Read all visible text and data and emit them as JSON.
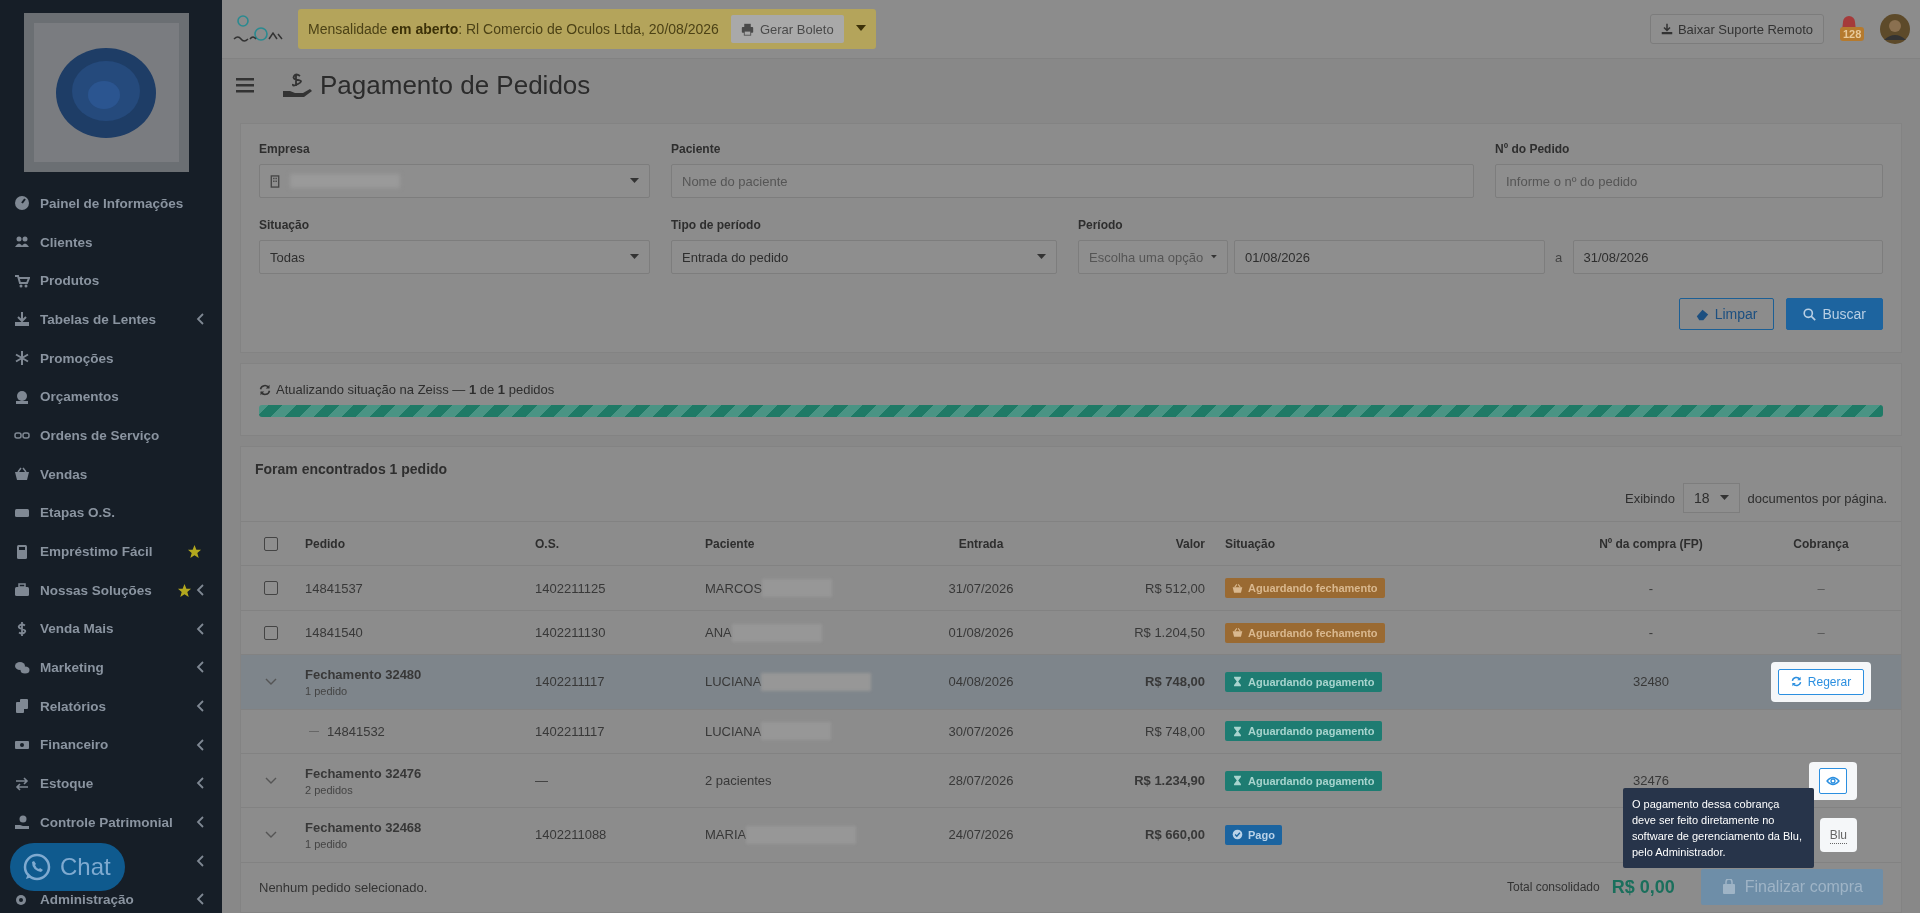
{
  "sidebar": {
    "items": [
      {
        "label": "Painel de Informações",
        "chevron": false,
        "star": false
      },
      {
        "label": "Clientes",
        "chevron": false,
        "star": false
      },
      {
        "label": "Produtos",
        "chevron": false,
        "star": false
      },
      {
        "label": "Tabelas de Lentes",
        "chevron": true,
        "star": false
      },
      {
        "label": "Promoções",
        "chevron": false,
        "star": false
      },
      {
        "label": "Orçamentos",
        "chevron": false,
        "star": false
      },
      {
        "label": "Ordens de Serviço",
        "chevron": false,
        "star": false
      },
      {
        "label": "Vendas",
        "chevron": false,
        "star": false
      },
      {
        "label": "Etapas O.S.",
        "chevron": false,
        "star": false
      },
      {
        "label": "Empréstimo Fácil",
        "chevron": false,
        "star": true
      },
      {
        "label": "Nossas Soluções",
        "chevron": true,
        "star": true
      },
      {
        "label": "Venda Mais",
        "chevron": true,
        "star": false
      },
      {
        "label": "Marketing",
        "chevron": true,
        "star": false
      },
      {
        "label": "Relatórios",
        "chevron": true,
        "star": false
      },
      {
        "label": "Financeiro",
        "chevron": true,
        "star": false
      },
      {
        "label": "Estoque",
        "chevron": true,
        "star": false
      },
      {
        "label": "Controle Patrimonial",
        "chevron": true,
        "star": false
      },
      {
        "chevron": true,
        "star": false
      },
      {
        "label": "Administração",
        "chevron": true,
        "star": false
      }
    ],
    "chat_button": "Chat"
  },
  "topbar": {
    "notice": {
      "text": "Mensalidade **em aberto**: Rl Comercio de Oculos Ltda, 20/08/2026",
      "button": "Gerar Boleto"
    },
    "support_button": "Baixar Suporte Remoto",
    "notifications": "128"
  },
  "page": {
    "title": "Pagamento de Pedidos"
  },
  "filters": {
    "fields": [
      {
        "label": "Empresa",
        "kind": "select"
      },
      {
        "label": "Paciente",
        "kind": "input",
        "placeholder": "Nome do paciente"
      },
      {
        "label": "Nº do Pedido",
        "kind": "input",
        "placeholder": "Informe o nº do pedido"
      },
      {
        "label": "Situação",
        "kind": "select",
        "value": "Todas"
      },
      {
        "label": "Tipo de período",
        "kind": "select",
        "value": "Entrada do pedido"
      },
      {
        "label": "Período",
        "kind": "range",
        "placeholder": "Escolha uma opção",
        "from": "01/08/2026",
        "separator": "a",
        "to": "31/08/2026"
      }
    ],
    "buttons": [
      {
        "label": "Limpar",
        "kind": "outline"
      },
      {
        "label": "Buscar",
        "kind": "primary"
      }
    ]
  },
  "progress": {
    "text": "Atualizando situação na Zeiss — **1** de **1** pedidos",
    "level": 1
  },
  "results": {
    "title": "Foram encontrados 1 pedido",
    "page_size": {
      "prefix": "Exibindo",
      "value": "18",
      "suffix": "documentos por página."
    },
    "select_all_checked": false,
    "columns": [
      "Pedido",
      "O.S.",
      "Paciente",
      "Entrada",
      "Valor",
      "Situação",
      "Nº da compra (FP)",
      "Cobrança"
    ],
    "rows": [
      {
        "kind": "order",
        "checked": false,
        "highlighted": false,
        "pedido": "14841537",
        "os": "1402211125",
        "paciente": "MARCOS",
        "redacted": true,
        "entrada": "31/07/2026",
        "valor": "R$ 512,00",
        "status": {
          "label": "Aguardando fechamento",
          "kind": "waiting_close"
        },
        "compra": "-",
        "cobranca": {
          "kind": "none",
          "text": "–"
        }
      },
      {
        "kind": "order",
        "checked": false,
        "highlighted": false,
        "pedido": "14841540",
        "os": "1402211130",
        "paciente": "ANA",
        "redacted": true,
        "entrada": "01/08/2026",
        "valor": "R$ 1.204,50",
        "status": {
          "label": "Aguardando fechamento",
          "kind": "waiting_close"
        },
        "compra": "-",
        "cobranca": {
          "kind": "none",
          "text": "–"
        }
      },
      {
        "kind": "closing",
        "highlighted": true,
        "pedido": "Fechamento 32480",
        "sub": "1 pedido",
        "os": "1402211117",
        "paciente": "LUCIANA",
        "redacted": true,
        "entrada": "04/08/2026",
        "valor": "R$ 748,00",
        "status": {
          "label": "Aguardando pagamento",
          "kind": "waiting_payment"
        },
        "compra": "32480",
        "cobranca": {
          "kind": "regenerate",
          "text": "Regerar"
        }
      },
      {
        "kind": "child",
        "highlighted": false,
        "pedido": "14841532",
        "os": "1402211117",
        "paciente": "LUCIANA",
        "redacted": true,
        "entrada": "30/07/2026",
        "valor": "R$ 748,00",
        "status": {
          "label": "Aguardando pagamento",
          "kind": "waiting_payment"
        }
      },
      {
        "kind": "closing",
        "highlighted": false,
        "pedido": "Fechamento 32476",
        "sub": "2 pedidos",
        "os": "—",
        "paciente": "2 pacientes",
        "redacted": false,
        "entrada": "28/07/2026",
        "valor": "R$ 1.234,90",
        "status": {
          "label": "Aguardando pagamento",
          "kind": "waiting_payment"
        },
        "compra": "32476",
        "cobranca": {
          "kind": "view"
        }
      },
      {
        "kind": "closing",
        "highlighted": false,
        "pedido": "Fechamento 32468",
        "sub": "1 pedido",
        "os": "1402211088",
        "paciente": "MARIA",
        "redacted": true,
        "entrada": "24/07/2026",
        "valor": "R$ 660,00",
        "status": {
          "label": "Pago",
          "kind": "paid"
        },
        "cobranca": {
          "kind": "blu",
          "text": "Blu"
        }
      }
    ],
    "tooltip": "O pagamento dessa cobrança deve ser feito diretamente no software de gerenciamento da Blu, pelo Administrador.",
    "footer": {
      "selection": "Nenhum pedido selecionado.",
      "total_label": "Total consolidado",
      "total": "R$ 0,00",
      "finish_button": "Finalizar compra",
      "finish_disabled": true
    }
  }
}
